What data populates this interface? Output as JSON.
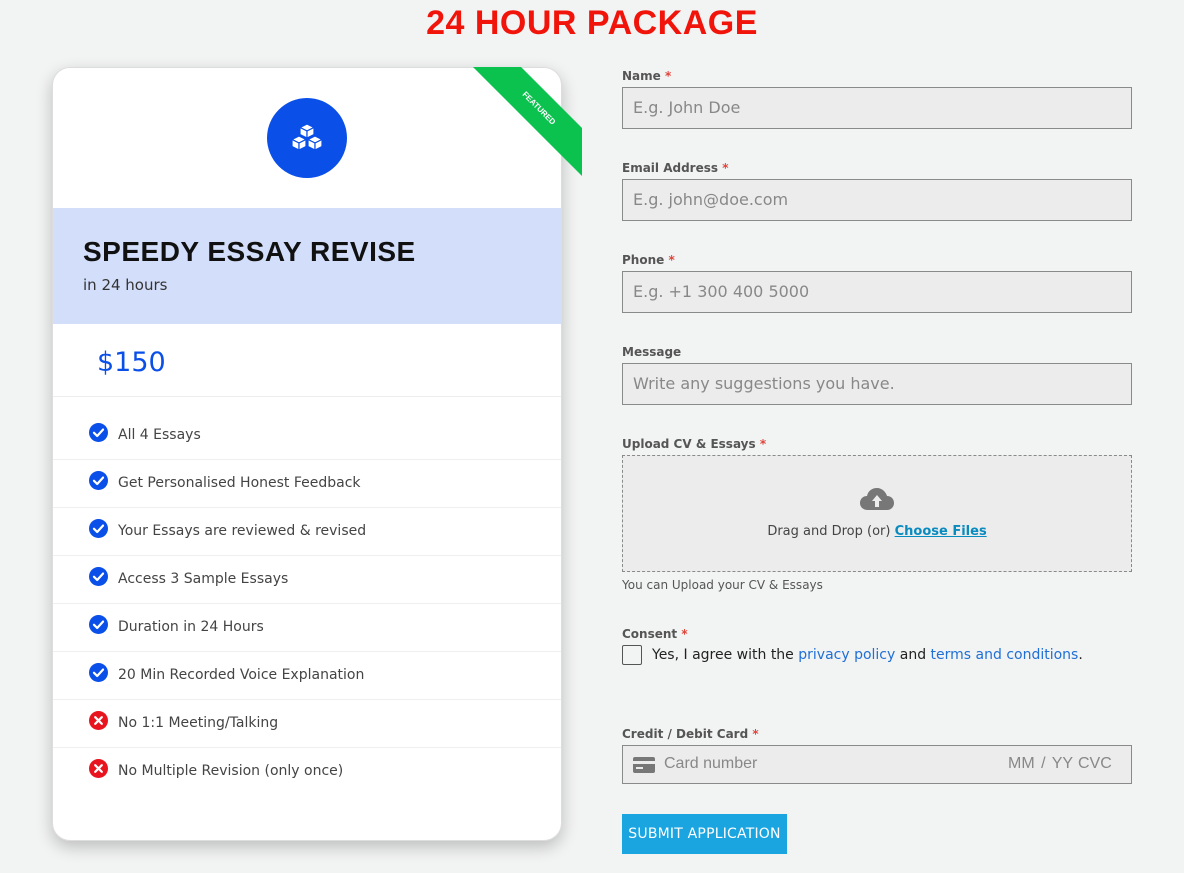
{
  "page": {
    "title": "24 HOUR PACKAGE"
  },
  "card": {
    "ribbon": "FEATURED",
    "icon": "cubes-icon",
    "title": "SPEEDY ESSAY REVISE",
    "subtitle": "in 24 hours",
    "price": "$150",
    "features": [
      {
        "text": "All 4 Essays",
        "included": true
      },
      {
        "text": "Get Personalised Honest Feedback",
        "included": true
      },
      {
        "text": "Your Essays are reviewed & revised",
        "included": true
      },
      {
        "text": "Access 3 Sample Essays",
        "included": true
      },
      {
        "text": "Duration in 24 Hours",
        "included": true
      },
      {
        "text": "20 Min Recorded Voice Explanation",
        "included": true
      },
      {
        "text": "No 1:1 Meeting/Talking",
        "included": false
      },
      {
        "text": "No Multiple Revision (only once)",
        "included": false
      }
    ]
  },
  "form": {
    "name": {
      "label": "Name",
      "required": "*",
      "placeholder": "E.g. John Doe"
    },
    "email": {
      "label": "Email Address",
      "required": "*",
      "placeholder": "E.g. john@doe.com"
    },
    "phone": {
      "label": "Phone",
      "required": "*",
      "placeholder": "E.g. +1 300 400 5000"
    },
    "message": {
      "label": "Message",
      "placeholder": "Write any suggestions you have."
    },
    "upload": {
      "label": "Upload CV & Essays",
      "required": "*",
      "drop_text": "Drag and Drop (or) ",
      "choose_link": "Choose Files",
      "help": "You can Upload your CV & Essays"
    },
    "consent": {
      "label": "Consent",
      "required": "*",
      "text_before": "Yes, I agree with the ",
      "privacy_link": "privacy policy",
      "text_middle": " and ",
      "terms_link": "terms and conditions",
      "text_after": "."
    },
    "card": {
      "label": "Credit / Debit Card",
      "required": "*",
      "number_placeholder": "Card number",
      "expiry_placeholder": "MM / YY",
      "cvc_placeholder": "CVC"
    },
    "submit_label": "SUBMIT APPLICATION"
  },
  "colors": {
    "accent": "#0a4fe8",
    "title_red": "#f0140a",
    "ribbon_green": "#0bc24f",
    "error_red": "#e8141e",
    "button": "#1aa5e0"
  }
}
